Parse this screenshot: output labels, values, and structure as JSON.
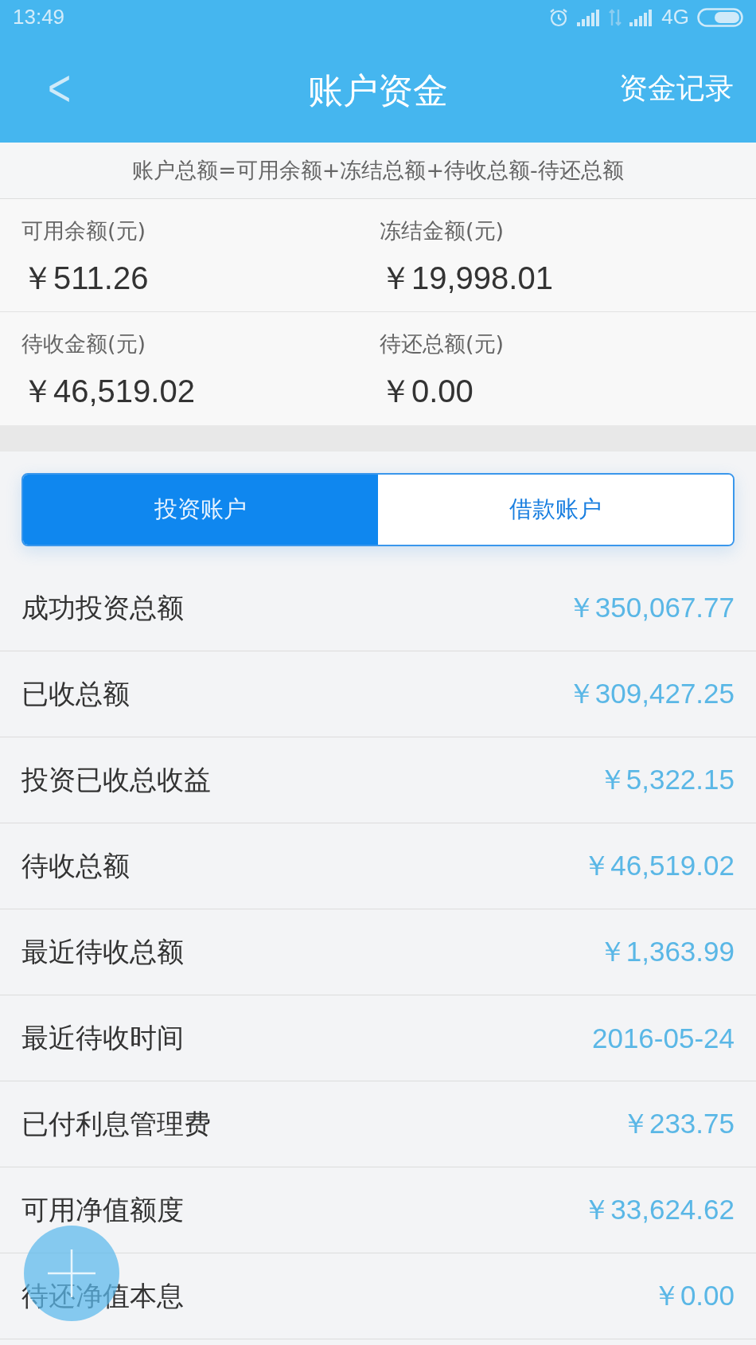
{
  "status_bar": {
    "time": "13:49",
    "network": "4G"
  },
  "header": {
    "back": "<",
    "title": "账户资金",
    "action": "资金记录"
  },
  "formula": "账户总额=可用余额+冻结总额+待收总额-待还总额",
  "summary": [
    {
      "label": "可用余额(元)",
      "value": "￥511.26"
    },
    {
      "label": "冻结金额(元)",
      "value": "￥19,998.01"
    },
    {
      "label": "待收金额(元)",
      "value": "￥46,519.02"
    },
    {
      "label": "待还总额(元)",
      "value": "￥0.00"
    }
  ],
  "tabs": [
    {
      "label": "投资账户",
      "selected": true
    },
    {
      "label": "借款账户",
      "selected": false
    }
  ],
  "rows": [
    {
      "label": "成功投资总额",
      "value": "￥350,067.77"
    },
    {
      "label": "已收总额",
      "value": "￥309,427.25"
    },
    {
      "label": "投资已收总收益",
      "value": "￥5,322.15"
    },
    {
      "label": "待收总额",
      "value": "￥46,519.02"
    },
    {
      "label": "最近待收总额",
      "value": "￥1,363.99"
    },
    {
      "label": "最近待收时间",
      "value": "2016-05-24"
    },
    {
      "label": "已付利息管理费",
      "value": "￥233.75"
    },
    {
      "label": "可用净值额度",
      "value": "￥33,624.62"
    },
    {
      "label": "待还净值本息",
      "value": "￥0.00"
    }
  ]
}
